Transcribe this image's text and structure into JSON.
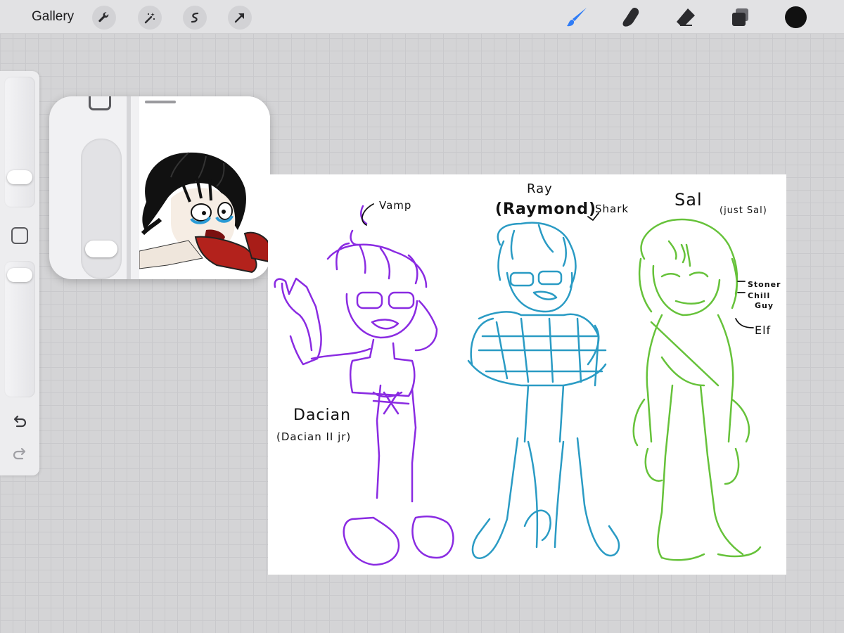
{
  "toolbar": {
    "gallery_label": "Gallery",
    "left_tools": [
      "wrench-icon",
      "magic-wand-icon",
      "selection-icon",
      "transform-arrow-icon"
    ],
    "right_tools": [
      "brush-icon",
      "smudge-icon",
      "eraser-icon",
      "layers-icon"
    ],
    "active_tool": "brush-icon",
    "accent_color": "#2f7cf6",
    "current_color": "#111111"
  },
  "sidebar": {
    "brush_size_level": 0.75,
    "opacity_level": 0.95
  },
  "canvas": {
    "characters": [
      {
        "name": "Dacian",
        "full_name": "(Dacian II jr)",
        "tag": "Vamp",
        "color": "#8a2be2"
      },
      {
        "name": "Ray",
        "full_name": "(Raymond)",
        "tag": "Shark",
        "color": "#2a9bc4"
      },
      {
        "name": "Sal",
        "full_name": "(just Sal)",
        "tag_lines": [
          "Stoner",
          "Chill",
          "Guy"
        ],
        "tag_extra": "Elf",
        "color": "#66c23a"
      }
    ]
  }
}
